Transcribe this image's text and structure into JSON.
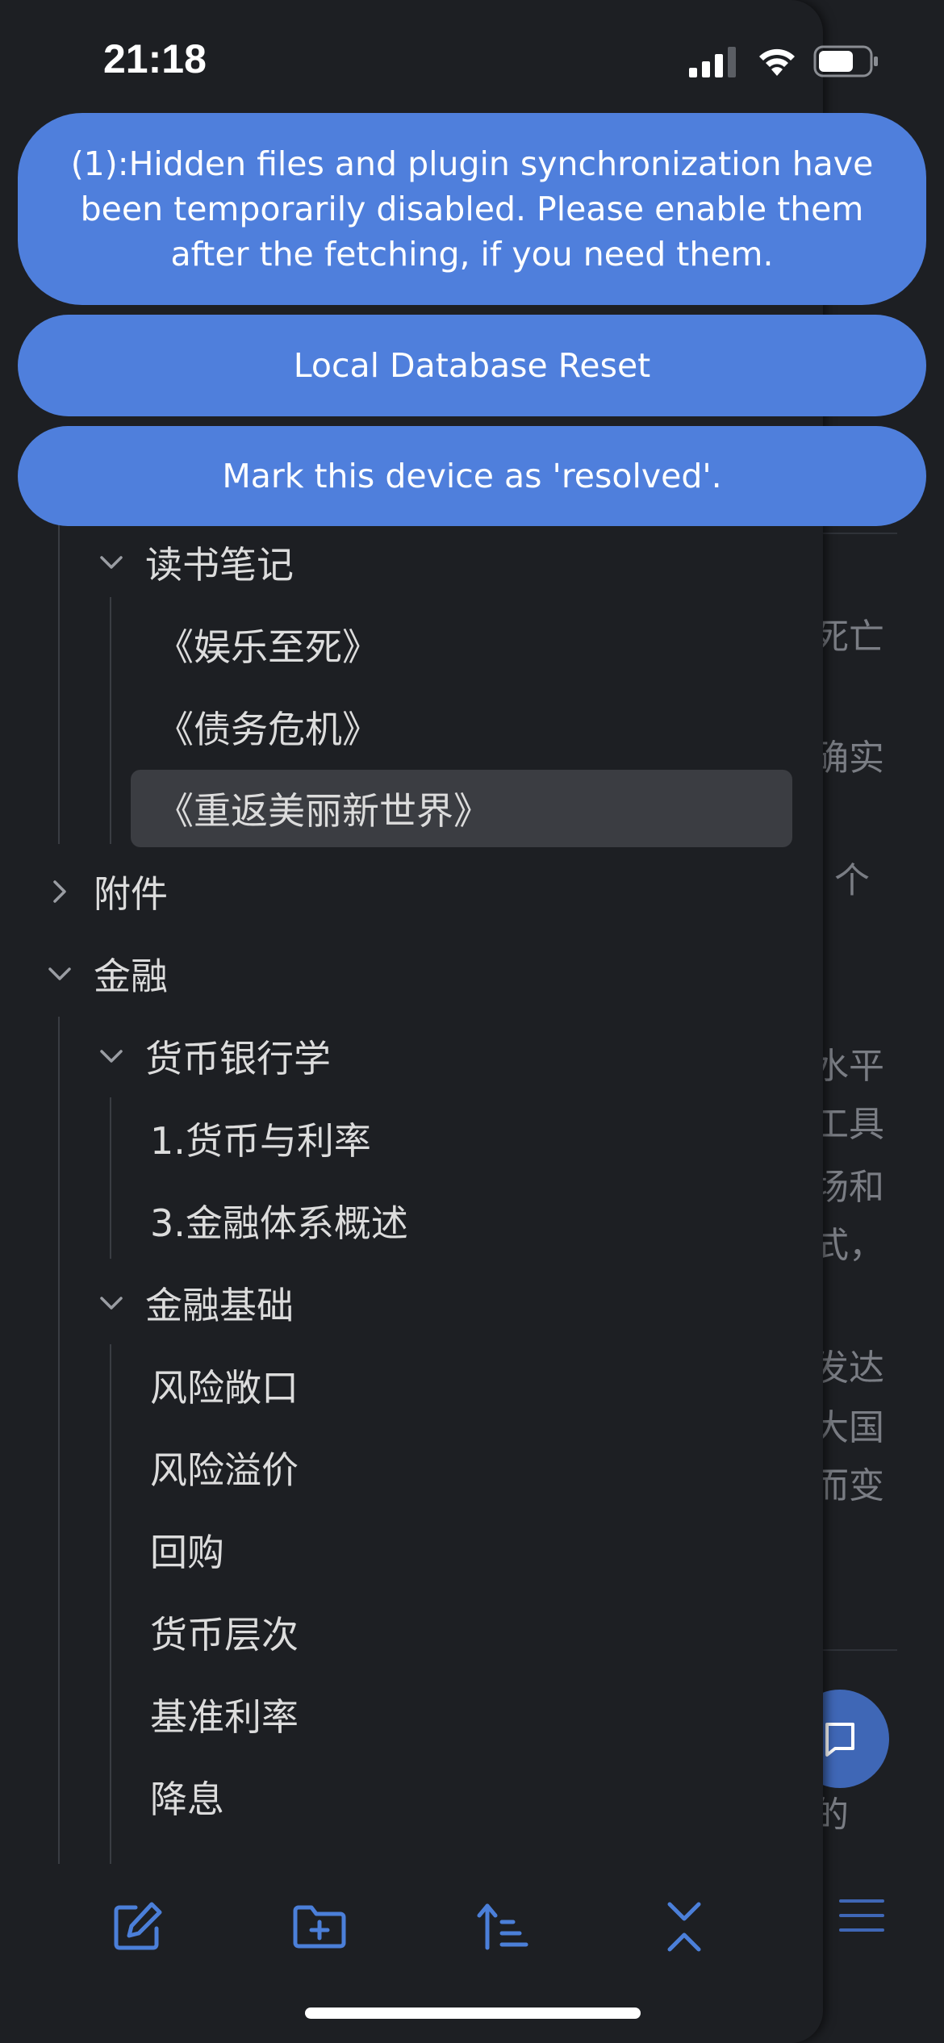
{
  "status_bar": {
    "time": "21:18"
  },
  "notifications": {
    "sync_notice": "(1):Hidden files and plugin synchronization have been temporarily disabled. Please enable them after the fetching, if you need them.",
    "reset_button": "Local Database Reset",
    "resolved_button": "Mark this device as 'resolved'."
  },
  "file_tree": {
    "reading_notes": {
      "label": "读书笔记",
      "expanded": true,
      "items": [
        "《娱乐至死》",
        "《债务危机》",
        "《重返美丽新世界》"
      ],
      "active_item": "《重返美丽新世界》"
    },
    "attachments": {
      "label": "附件",
      "expanded": false
    },
    "finance": {
      "label": "金融",
      "expanded": true,
      "money_banking": {
        "label": "货币银行学",
        "expanded": true,
        "items": [
          "1.货币与利率",
          "3.金融体系概述"
        ]
      },
      "finance_basics": {
        "label": "金融基础",
        "expanded": true,
        "items": [
          "风险敞口",
          "风险溢价",
          "回购",
          "货币层次",
          "基准利率",
          "降息"
        ]
      }
    }
  },
  "editor_peek": {
    "lines": [
      "死亡",
      "确实",
      "个",
      "水平",
      "工具",
      "场和",
      "式，",
      "发达",
      "大国",
      "而变",
      "的"
    ]
  },
  "toolbar": {
    "icons": [
      "new-note-icon",
      "new-folder-icon",
      "sort-icon",
      "collapse-all-icon"
    ]
  },
  "colors": {
    "accent": "#4f7fdc",
    "icon_blue": "#4b7fd9",
    "drawer_bg": "#1d1f23",
    "active_row": "#3b3d42"
  }
}
